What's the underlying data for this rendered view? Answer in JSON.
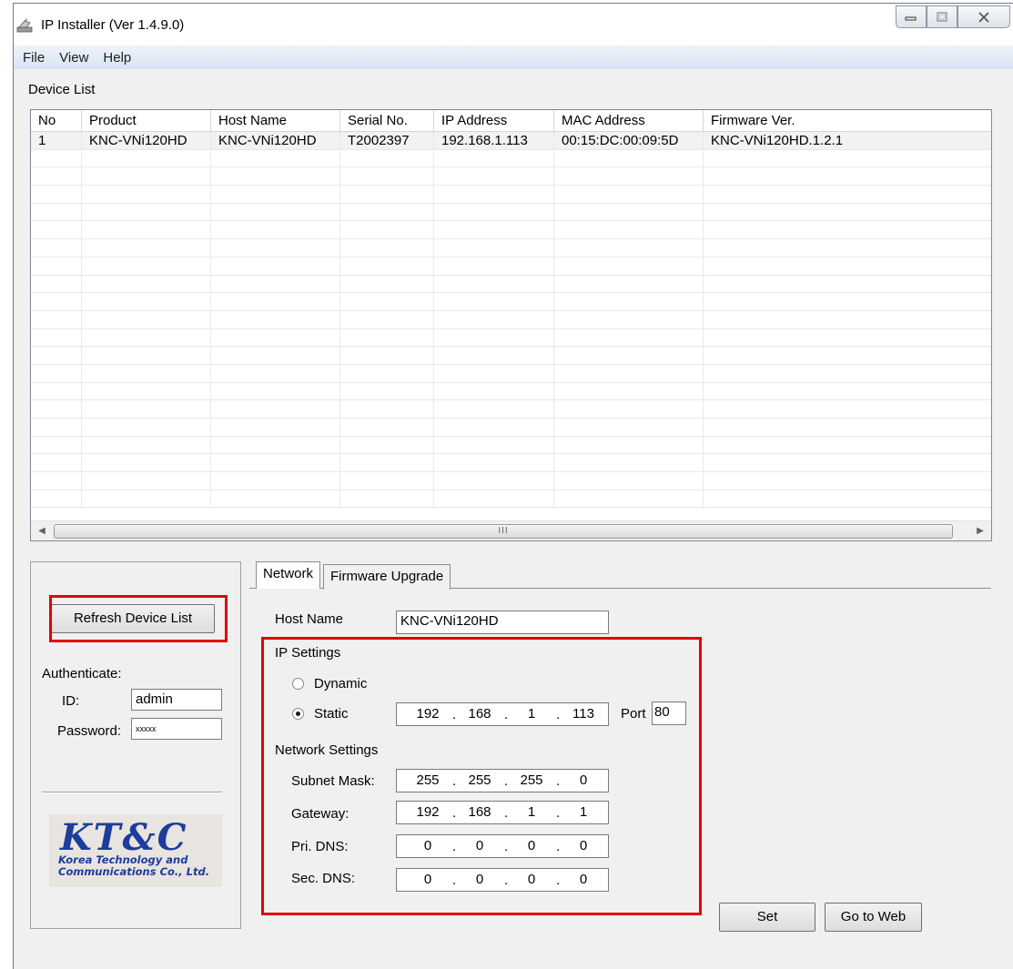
{
  "window": {
    "title": "IP Installer (Ver 1.4.9.0)",
    "minimize_icon": "minimize-icon",
    "maximize_icon": "maximize-icon",
    "close_icon": "close-icon"
  },
  "menu": [
    "File",
    "View",
    "Help"
  ],
  "device_list": {
    "label": "Device List",
    "columns": [
      "No",
      "Product",
      "Host Name",
      "Serial No.",
      "IP Address",
      "MAC Address",
      "Firmware Ver."
    ],
    "rows": [
      [
        "1",
        "KNC-VNi120HD",
        "KNC-VNi120HD",
        "T2002397",
        "192.168.1.113",
        "00:15:DC:00:09:5D",
        "KNC-VNi120HD.1.2.1"
      ]
    ],
    "scroll_thumb_grip": "III"
  },
  "left_panel": {
    "refresh_button": "Refresh Device List",
    "authenticate_label": "Authenticate:",
    "id_label": "ID:",
    "id_value": "admin",
    "password_label": "Password:",
    "password_value": "xxxxx",
    "logo": {
      "title": "KT&C",
      "line1": "Korea Technology and",
      "line2": "Communications Co., Ltd."
    }
  },
  "tabs": [
    "Network",
    "Firmware Upgrade"
  ],
  "network": {
    "host_name_label": "Host Name",
    "host_name_value": "KNC-VNi120HD",
    "ip_settings_label": "IP Settings",
    "dynamic_label": "Dynamic",
    "static_label": "Static",
    "selected_mode": "Static",
    "static_ip": [
      "192",
      "168",
      "1",
      "113"
    ],
    "port_label": "Port",
    "port_value": "80",
    "network_settings_label": "Network Settings",
    "subnet_label": "Subnet Mask:",
    "subnet": [
      "255",
      "255",
      "255",
      "0"
    ],
    "gateway_label": "Gateway:",
    "gateway": [
      "192",
      "168",
      "1",
      "1"
    ],
    "pri_dns_label": "Pri. DNS:",
    "pri_dns": [
      "0",
      "0",
      "0",
      "0"
    ],
    "sec_dns_label": "Sec. DNS:",
    "sec_dns": [
      "0",
      "0",
      "0",
      "0"
    ]
  },
  "buttons": {
    "set": "Set",
    "go_to_web": "Go to Web"
  },
  "colors": {
    "highlight_box": "#e30000",
    "logo_blue": "#1c3d9c"
  }
}
